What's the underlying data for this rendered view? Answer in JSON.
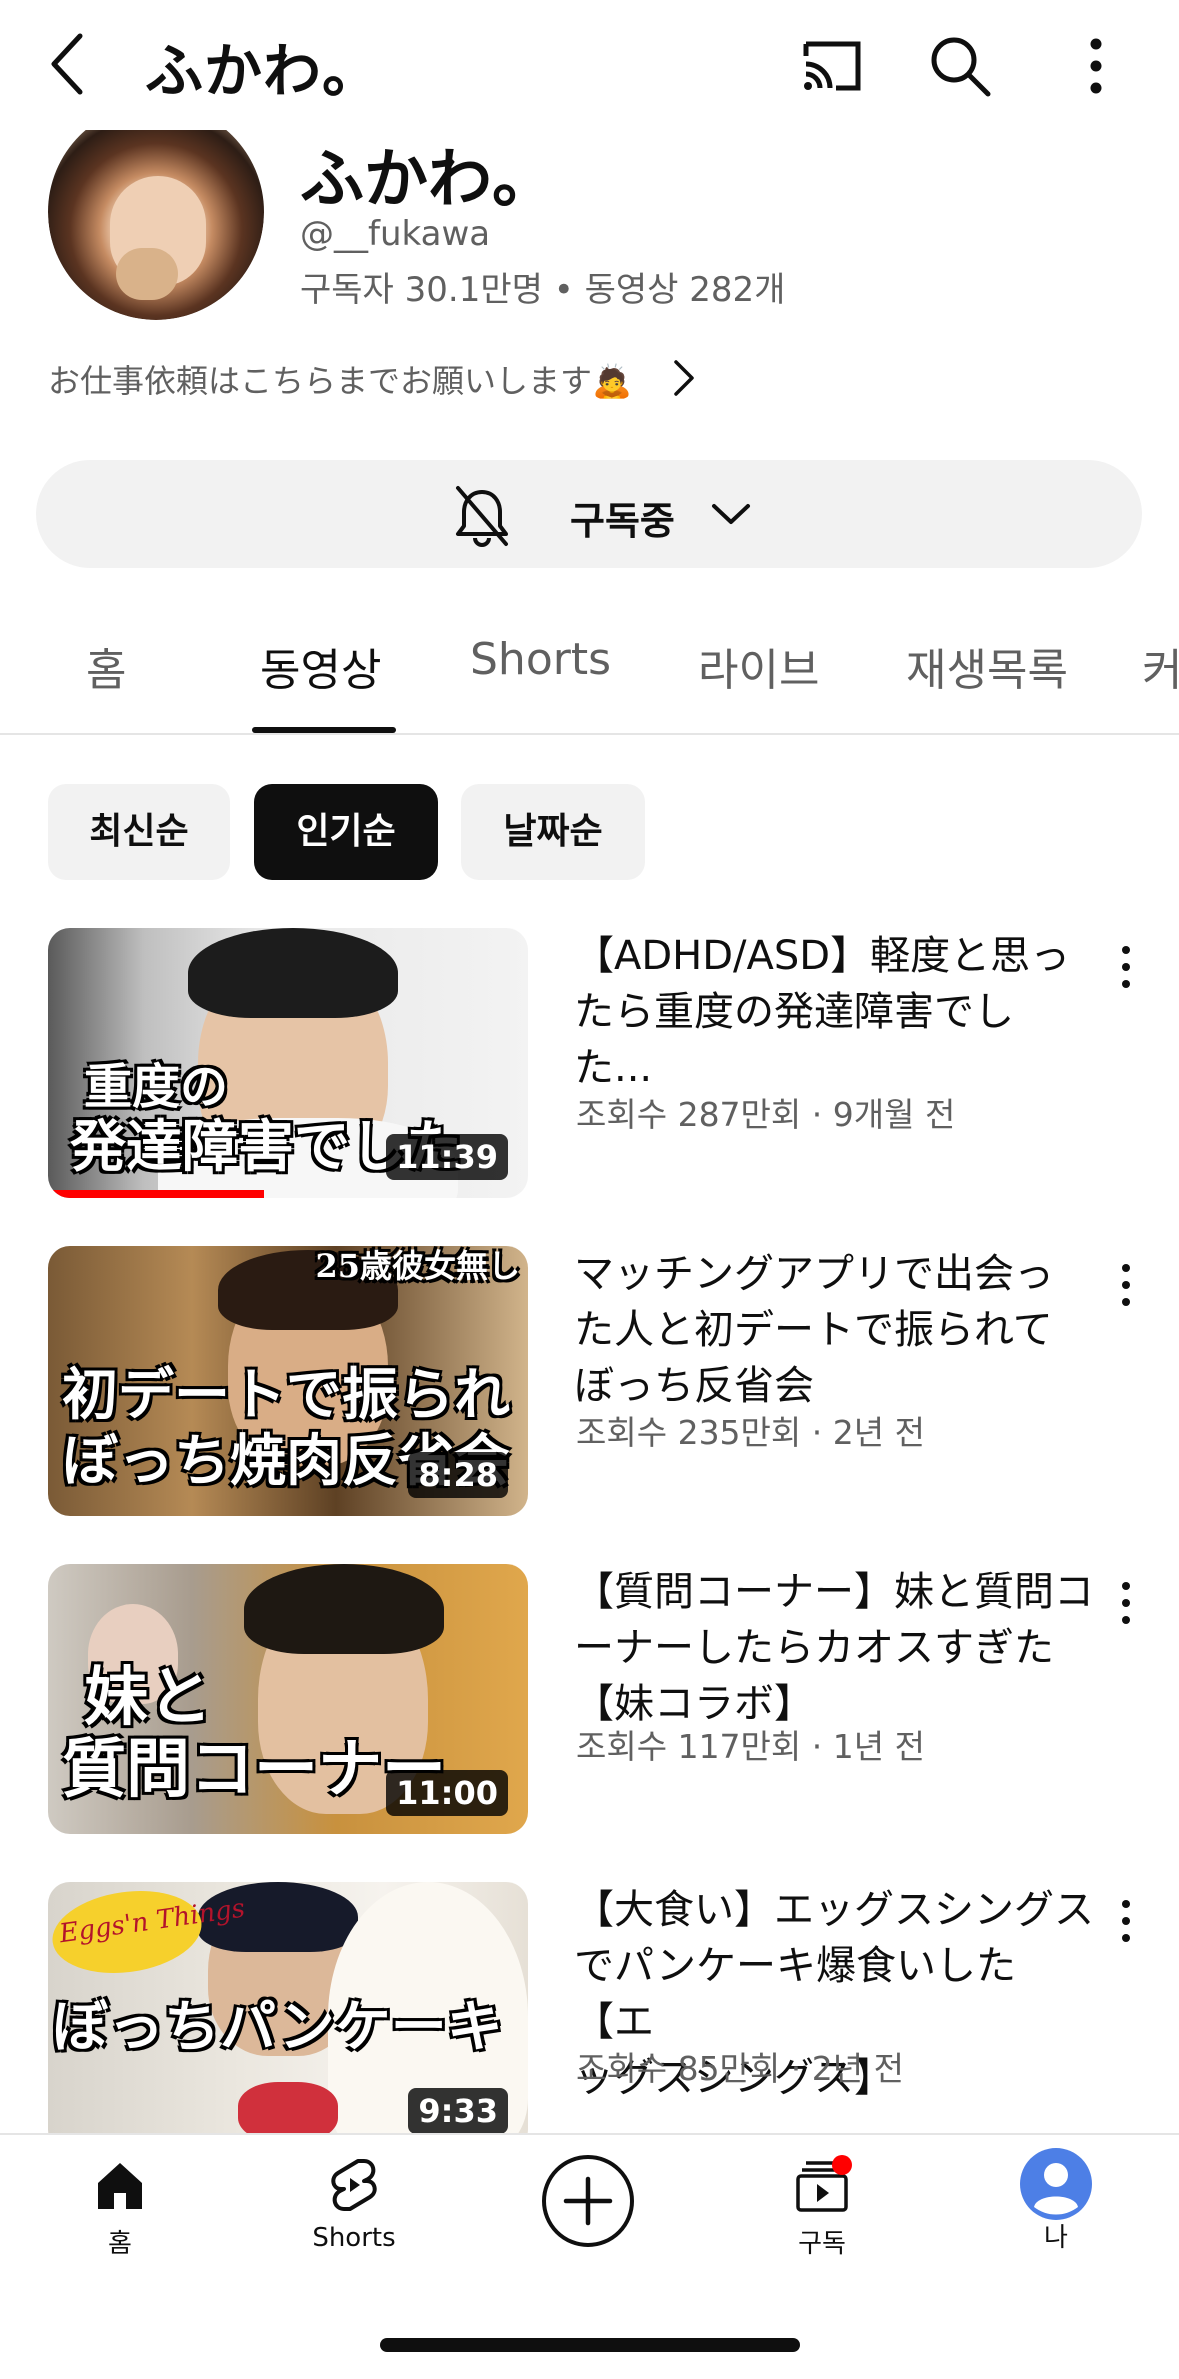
{
  "topbar": {
    "title": "ふかわ。",
    "icons": [
      "back-arrow-icon",
      "cast-icon",
      "search-icon",
      "more-vert-icon"
    ]
  },
  "channel": {
    "name": "ふかわ。",
    "handle": "@__fukawa",
    "stats": "구독자 30.1만명 • 동영상 282개",
    "description": "お仕事依頼はこちらまでお願いします🙇"
  },
  "subscribe": {
    "label": "구독중",
    "icons": [
      "bell-off-icon",
      "chevron-down-icon"
    ]
  },
  "tabs": [
    {
      "label": "홈",
      "active": false
    },
    {
      "label": "동영상",
      "active": true
    },
    {
      "label": "Shorts",
      "active": false
    },
    {
      "label": "라이브",
      "active": false
    },
    {
      "label": "재생목록",
      "active": false
    },
    {
      "label": "커",
      "active": false
    }
  ],
  "chips": [
    {
      "label": "최신순",
      "active": false
    },
    {
      "label": "인기순",
      "active": true
    },
    {
      "label": "날짜순",
      "active": false
    }
  ],
  "videos": [
    {
      "title": "【ADHD/ASD】軽度と思ったら重度の発達障害でした...",
      "title_lines": [
        "【ADHD/ASD】軽度と思っ",
        "たら重度の発達障害でし",
        "た..."
      ],
      "meta": "조회수 287만회 · 9개월 전",
      "duration": "11:39",
      "overlay_lines": [
        "重度の",
        "発達障害でした"
      ],
      "watched_fraction": 0.45
    },
    {
      "title": "マッチングアプリで出会った人と初デートで振られてぼっち反省会",
      "title_lines": [
        "マッチングアプリで出会っ",
        "た人と初デートで振られて",
        "ぼっち反省会"
      ],
      "meta": "조회수 235만회 · 2년 전",
      "duration": "8:28",
      "overlay_top": "25歳彼女無し",
      "overlay_lines": [
        "初デートで振られ",
        "ぼっち焼肉反省会"
      ]
    },
    {
      "title": "【質問コーナー】妹と質問コーナーしたらカオスすぎた【妹コラボ】",
      "title_lines": [
        "【質問コーナー】妹と質問コ",
        "ーナーしたらカオスすぎた",
        "【妹コラボ】"
      ],
      "meta": "조회수 117만회 · 1년 전",
      "duration": "11:00",
      "overlay_lines": [
        "妹と",
        "質問コーナー"
      ]
    },
    {
      "title": "【大食い】エッグスシングスでパンケーキ爆食いした【エッグスシングス】",
      "title_lines": [
        "【大食い】エッグスシングス",
        "でパンケーキ爆食いした【エ",
        "ッグスシングス】"
      ],
      "meta": "조회수 85만회 · 2년 전",
      "duration": "9:33",
      "overlay_logo": "Eggs'n Things",
      "overlay_lines": [
        "ぼっちパンケーキ"
      ]
    }
  ],
  "bottom_nav": [
    {
      "label": "홈",
      "icon": "home-icon"
    },
    {
      "label": "Shorts",
      "icon": "shorts-icon"
    },
    {
      "label": "",
      "icon": "create-plus-icon"
    },
    {
      "label": "구독",
      "icon": "subscriptions-icon"
    },
    {
      "label": "나",
      "icon": "account-avatar-icon"
    }
  ],
  "colors": {
    "accent_red": "#ff0000",
    "text_primary": "#0f0f0f",
    "text_secondary": "#606060",
    "chip_bg": "#f2f2f2",
    "avatar_blue": "#4d7fe6"
  }
}
